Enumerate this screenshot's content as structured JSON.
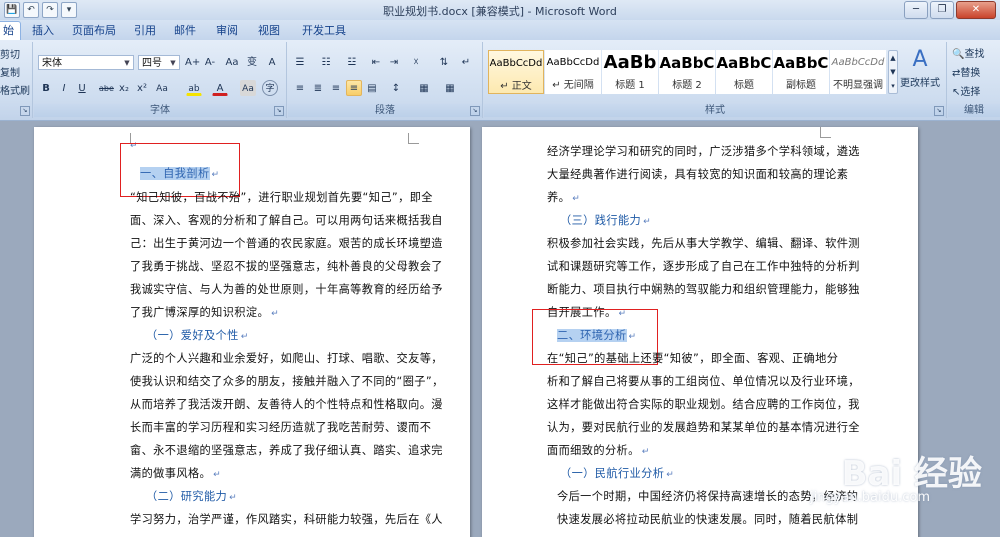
{
  "window": {
    "title": "职业规划书.docx [兼容模式] - Microsoft Word",
    "minimize": "─",
    "restore": "❐",
    "close": "✕"
  },
  "qat": [
    "💾",
    "↶",
    "↷",
    "▾"
  ],
  "tabs": [
    "始",
    "插入",
    "页面布局",
    "引用",
    "邮件",
    "审阅",
    "视图",
    "开发工具"
  ],
  "clipboard": {
    "cut": "剪切",
    "copy": "复制",
    "format_painter": "格式刷"
  },
  "font": {
    "name": "宋体",
    "size": "四号",
    "label": "字体",
    "row1": [
      "A+",
      "A-",
      "Aa",
      "变",
      "A"
    ],
    "row2": [
      "B",
      "I",
      "U",
      "abe",
      "x₂",
      "x²",
      "Aa",
      "ab",
      "A",
      "Aa",
      "字"
    ]
  },
  "paragraph": {
    "label": "段落",
    "row1": [
      "☰",
      "☷",
      "☳",
      "⇤",
      "⇥",
      "☓",
      "⇅",
      "↵"
    ],
    "row2": [
      "≡",
      "≣",
      "≡",
      "≡",
      "▤",
      "↕",
      "▦",
      "▦"
    ]
  },
  "styles": {
    "label": "样式",
    "change": "更改样式",
    "items": [
      {
        "sample": "AaBbCcDd",
        "name": "↵ 正文"
      },
      {
        "sample": "AaBbCcDd",
        "name": "↵ 无间隔"
      },
      {
        "sample": "AaBb",
        "name": "标题 1"
      },
      {
        "sample": "AaBbC",
        "name": "标题 2"
      },
      {
        "sample": "AaBbC",
        "name": "标题"
      },
      {
        "sample": "AaBbC",
        "name": "副标题"
      },
      {
        "sample": "AaBbCcDd",
        "name": "不明显强调"
      }
    ]
  },
  "editing": {
    "label": "编辑",
    "find": "查找",
    "replace": "替换",
    "select": "选择"
  },
  "page_left": {
    "lines": [
      "↵",
      "一、自我剖析",
      "“知己知彼，百战不殆”，进行职业规划首先要“知己”，即全",
      "面、深入、客观的分析和了解自己。可以用两句话来概括我自",
      "己：出生于黄河边一个普通的农民家庭。艰苦的成长环境塑造",
      "了我勇于挑战、坚忍不拔的坚强意志，纯朴善良的父母教会了",
      "我诚实守信、与人为善的处世原则，十年高等教育的经历给予",
      "了我广博深厚的知识积淀。",
      "（一）爱好及个性",
      "广泛的个人兴趣和业余爱好，如爬山、打球、唱歌、交友等，",
      "使我认识和结交了众多的朋友，接触并融入了不同的“圈子”，",
      "从而培养了我活泼开朗、友善待人的个性特点和性格取向。漫",
      "长而丰富的学习历程和实习经历造就了我吃苦耐劳、谡而不",
      "畲、永不退缩的坚强意志，养成了我仔细认真、踏实、追求完",
      "满的做事风格。",
      "（二）研究能力",
      "学习努力，治学严谨，作风踏实，科研能力较强，先后在《人"
    ]
  },
  "page_right": {
    "lines": [
      "经济学理论学习和研究的同时，广泛涉猎多个学科领域，遴选",
      "大量经典著作进行阅读，具有较宽的知识面和较高的理论素",
      "养。",
      "（三）践行能力",
      "积极参加社会实践，先后从事大学教学、编辑、翻译、软件测",
      "试和课题研究等工作，逐步形成了自己在工作中独特的分析判",
      "断能力、项目执行中娴熟的驾驭能力和组织管理能力，能够独",
      "自开展工作。",
      "二、环境分析",
      "在“知己”的基础上还要“知彼”，即全面、客观、正确地分",
      "析和了解自己将要从事的工组岗位、单位情况以及行业环境，",
      "这样才能做出符合实际的职业规划。结合应聘的工作岗位，我",
      "认为，要对民航行业的发展趋势和某某单位的基本情况进行全",
      "面而细致的分析。",
      "（一）民航行业分析",
      "今后一个时期，中国经济仍将保持高速增长的态势，经济的",
      "快速发展必将拉动民航业的快速发展。同时，随着民航体制"
    ]
  },
  "watermark": {
    "text": "Bai 经验",
    "sub": "jingyan.baidu.com"
  }
}
